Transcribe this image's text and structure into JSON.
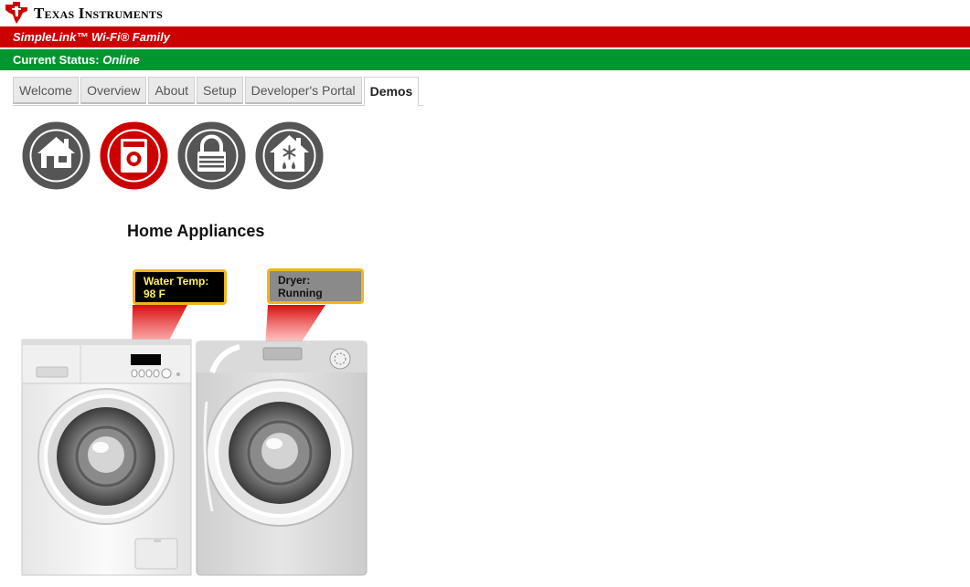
{
  "header": {
    "logo_text": "Texas Instruments",
    "family_label": "SimpleLink™ Wi-Fi® Family",
    "status_prefix": "Current Status:",
    "status_value": "Online"
  },
  "tabs": [
    {
      "label": "Welcome"
    },
    {
      "label": "Overview"
    },
    {
      "label": "About"
    },
    {
      "label": "Setup"
    },
    {
      "label": "Developer's Portal"
    },
    {
      "label": "Demos",
      "active": true
    }
  ],
  "demo_icons": [
    {
      "name": "home-icon",
      "selected": false
    },
    {
      "name": "washer-icon",
      "selected": true
    },
    {
      "name": "lock-icon",
      "selected": false
    },
    {
      "name": "thermostat-house-icon",
      "selected": false
    }
  ],
  "section_title": "Home Appliances",
  "washer": {
    "callout_line1": "Water Temp:",
    "callout_line2": "98 F"
  },
  "dryer": {
    "callout_line1": "Dryer:",
    "callout_line2": "Running"
  },
  "colors": {
    "brand_red": "#cc0000",
    "status_green": "#00962f",
    "icon_gray": "#555555",
    "callout_border": "#f2b51d",
    "washer_callout_bg": "#000000",
    "washer_callout_text": "#fff05a",
    "dryer_callout_bg": "#8a8a8a"
  }
}
